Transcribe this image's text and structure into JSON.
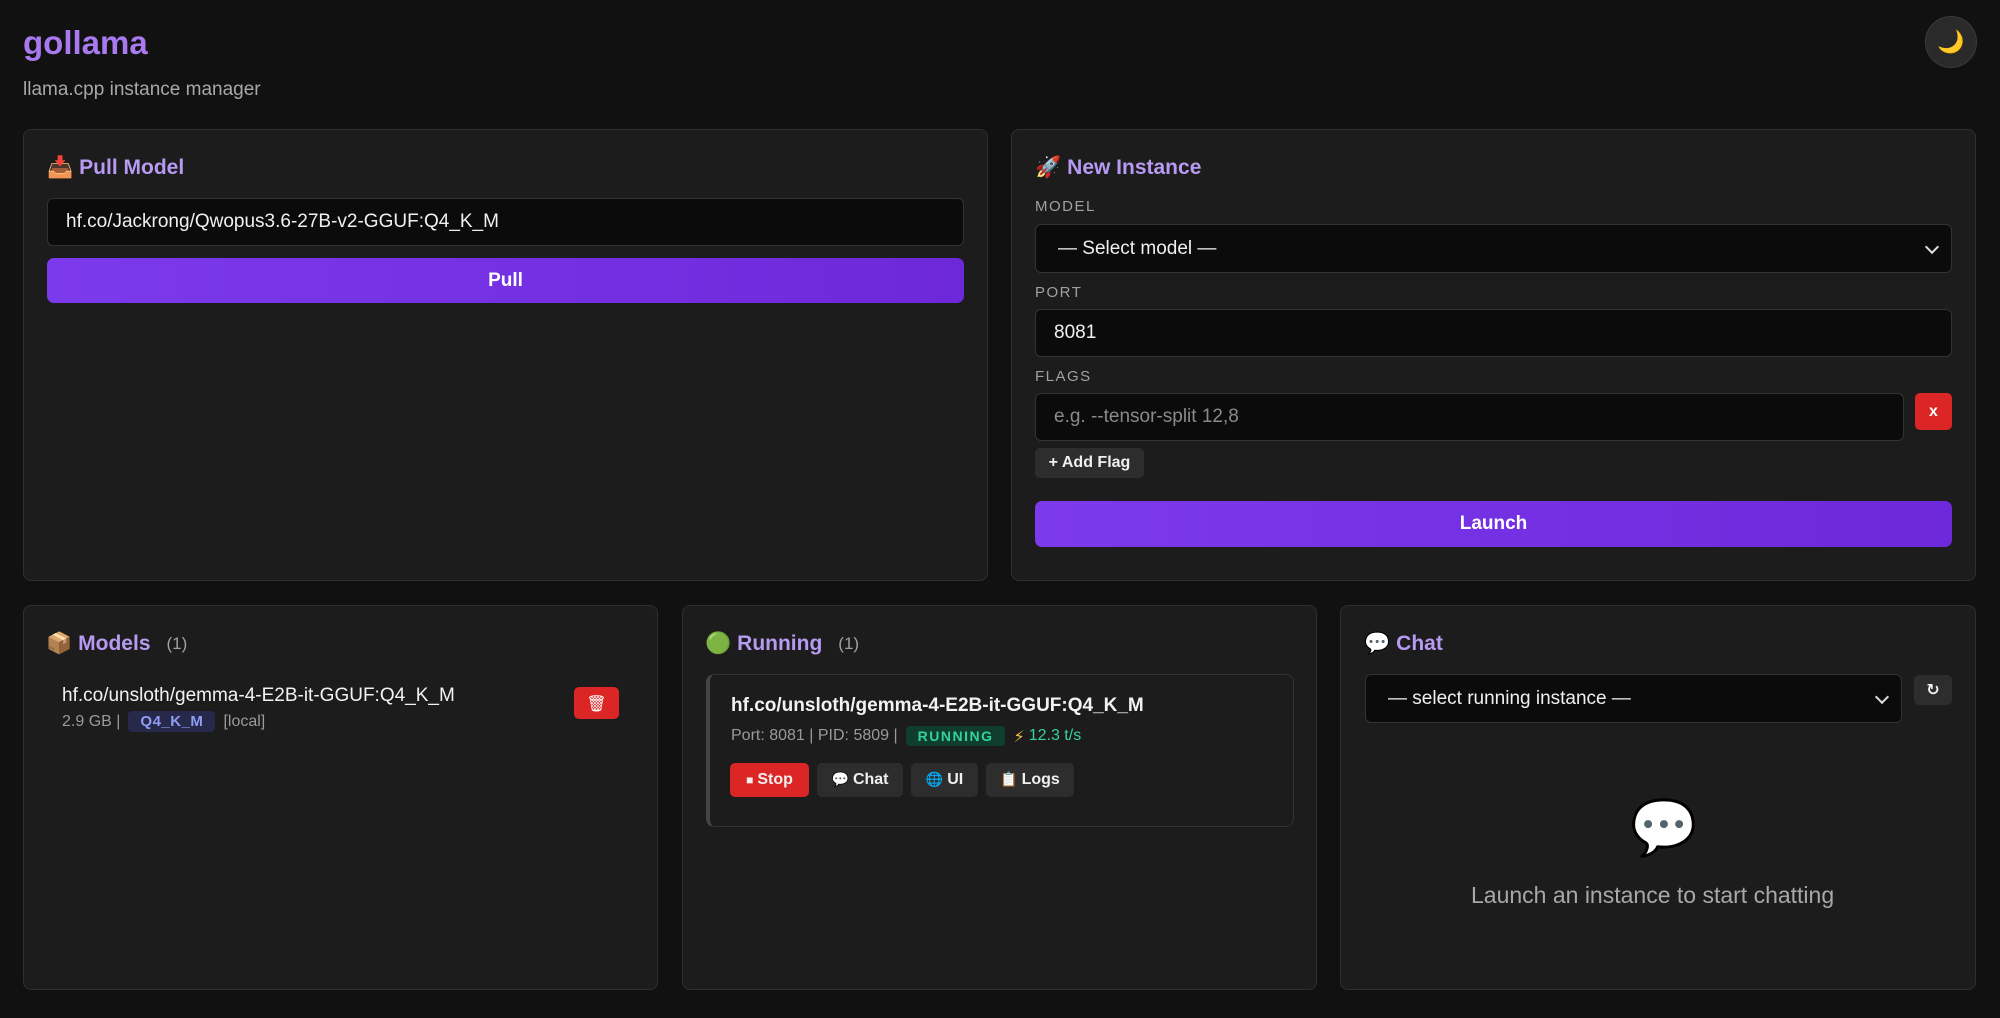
{
  "header": {
    "title": "gollama",
    "subtitle": "llama.cpp instance manager",
    "theme_toggle_icon": "🌙"
  },
  "pull_panel": {
    "icon": "📥",
    "title": "Pull Model",
    "input_value": "hf.co/Jackrong/Qwopus3.6-27B-v2-GGUF:Q4_K_M",
    "pull_label": "Pull"
  },
  "new_instance_panel": {
    "icon": "🚀",
    "title": "New Instance",
    "model_label": "Model",
    "model_select": "— Select model —",
    "port_label": "Port",
    "port_value": "8081",
    "flags_label": "Flags",
    "flag_placeholder": "e.g. --tensor-split 12,8",
    "remove_flag_label": "x",
    "add_flag_label": "+ Add Flag",
    "launch_label": "Launch"
  },
  "models_panel": {
    "icon": "📦",
    "title": "Models",
    "count": "(1)",
    "items": [
      {
        "name": "hf.co/unsloth/gemma-4-E2B-it-GGUF:Q4_K_M",
        "size": "2.9 GB |",
        "quant": "Q4_K_M",
        "source": "[local]",
        "delete_icon": "🗑"
      }
    ]
  },
  "running_panel": {
    "icon": "🟢",
    "title": "Running",
    "count": "(1)",
    "items": [
      {
        "name": "hf.co/unsloth/gemma-4-E2B-it-GGUF:Q4_K_M",
        "port_pid": "Port: 8081 | PID: 5809 |",
        "status": "RUNNING",
        "speed_icon": "⚡",
        "speed": "12.3 t/s",
        "actions": {
          "stop_icon": "■",
          "stop": "Stop",
          "chat_icon": "💬",
          "chat": "Chat",
          "ui_icon": "🌐",
          "ui": "UI",
          "logs_icon": "📋",
          "logs": "Logs"
        }
      }
    ]
  },
  "chat_panel": {
    "icon": "💬",
    "title": "Chat",
    "instance_select": "— select running instance —",
    "refresh_icon": "↻",
    "empty_icon": "💬",
    "empty_text": "Launch an instance to start chatting"
  },
  "colors": {
    "accent": "#7c3aed",
    "title": "#a979f0",
    "danger": "#dc2626",
    "success": "#34d399"
  }
}
